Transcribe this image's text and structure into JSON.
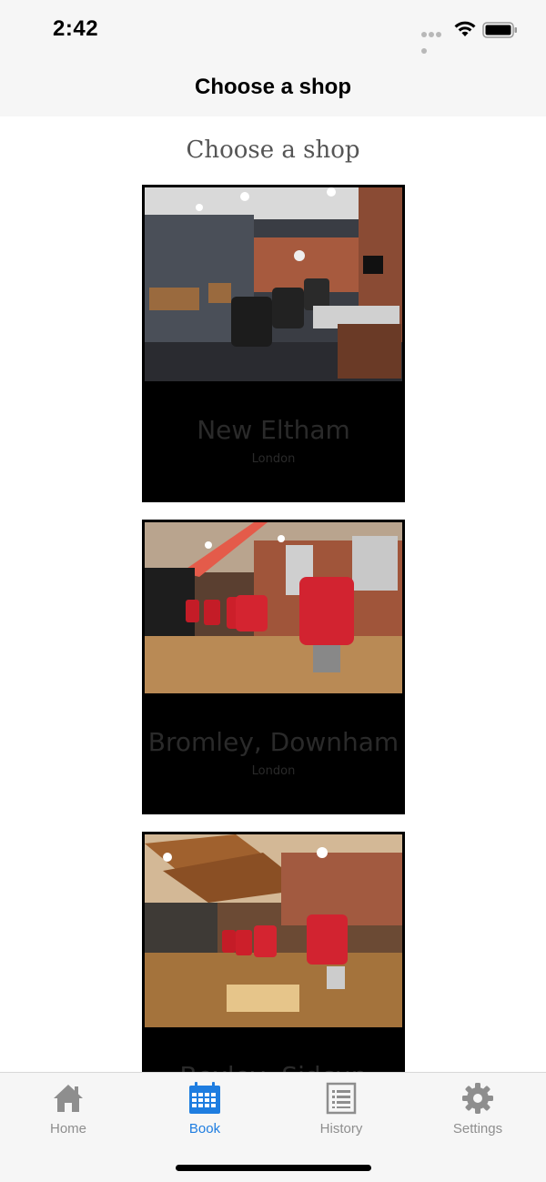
{
  "status_bar": {
    "time": "2:42",
    "icons": [
      "signal-dots-icon",
      "wifi-icon",
      "battery-icon"
    ]
  },
  "nav": {
    "title": "Choose a shop"
  },
  "page": {
    "heading": "Choose a shop"
  },
  "shops": [
    {
      "name": "New Eltham",
      "city": "London"
    },
    {
      "name": "Bromley, Downham",
      "city": "London"
    },
    {
      "name": "Bexley, Sidcup",
      "city": ""
    }
  ],
  "tabs": [
    {
      "label": "Home",
      "icon": "home-icon",
      "active": false
    },
    {
      "label": "Book",
      "icon": "calendar-icon",
      "active": true
    },
    {
      "label": "History",
      "icon": "history-icon",
      "active": false
    },
    {
      "label": "Settings",
      "icon": "gear-icon",
      "active": false
    }
  ],
  "colors": {
    "accent": "#1e7de0",
    "inactive_tab": "#8e8e8e",
    "bar_background": "#f6f6f6",
    "card_background": "#000000"
  }
}
